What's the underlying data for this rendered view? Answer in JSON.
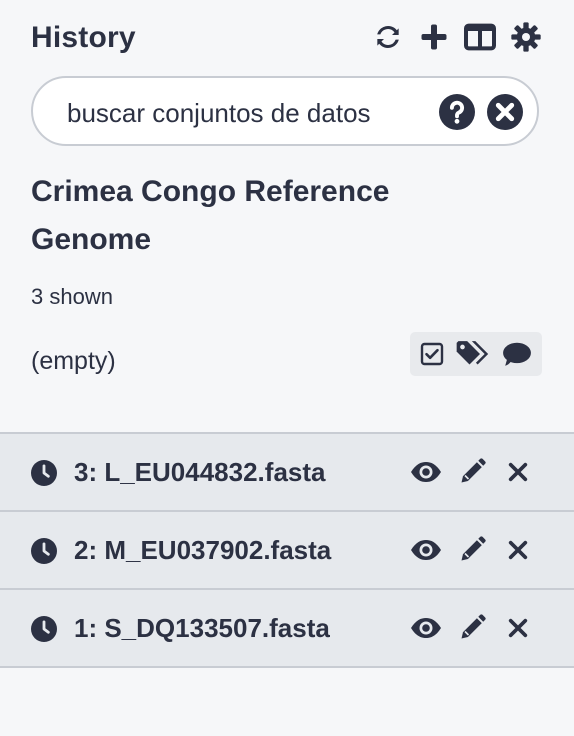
{
  "panel": {
    "title": "History",
    "icons": [
      "sync-icon",
      "plus-icon",
      "columns-icon",
      "gear-icon"
    ]
  },
  "search": {
    "placeholder": "buscar conjuntos de datos",
    "value": ""
  },
  "history": {
    "name": "Crimea Congo Reference Genome",
    "shown": "3 shown",
    "size": "(empty)"
  },
  "datasets": [
    {
      "label": "3: L_EU044832.fasta",
      "state_icon": "clock-icon"
    },
    {
      "label": "2: M_EU037902.fasta",
      "state_icon": "clock-icon"
    },
    {
      "label": "1: S_DQ133507.fasta",
      "state_icon": "clock-icon"
    }
  ],
  "colors": {
    "text": "#2c3143",
    "background": "#f6f7f9",
    "row_background": "#e6e9ed",
    "border": "#c8ccd3"
  }
}
